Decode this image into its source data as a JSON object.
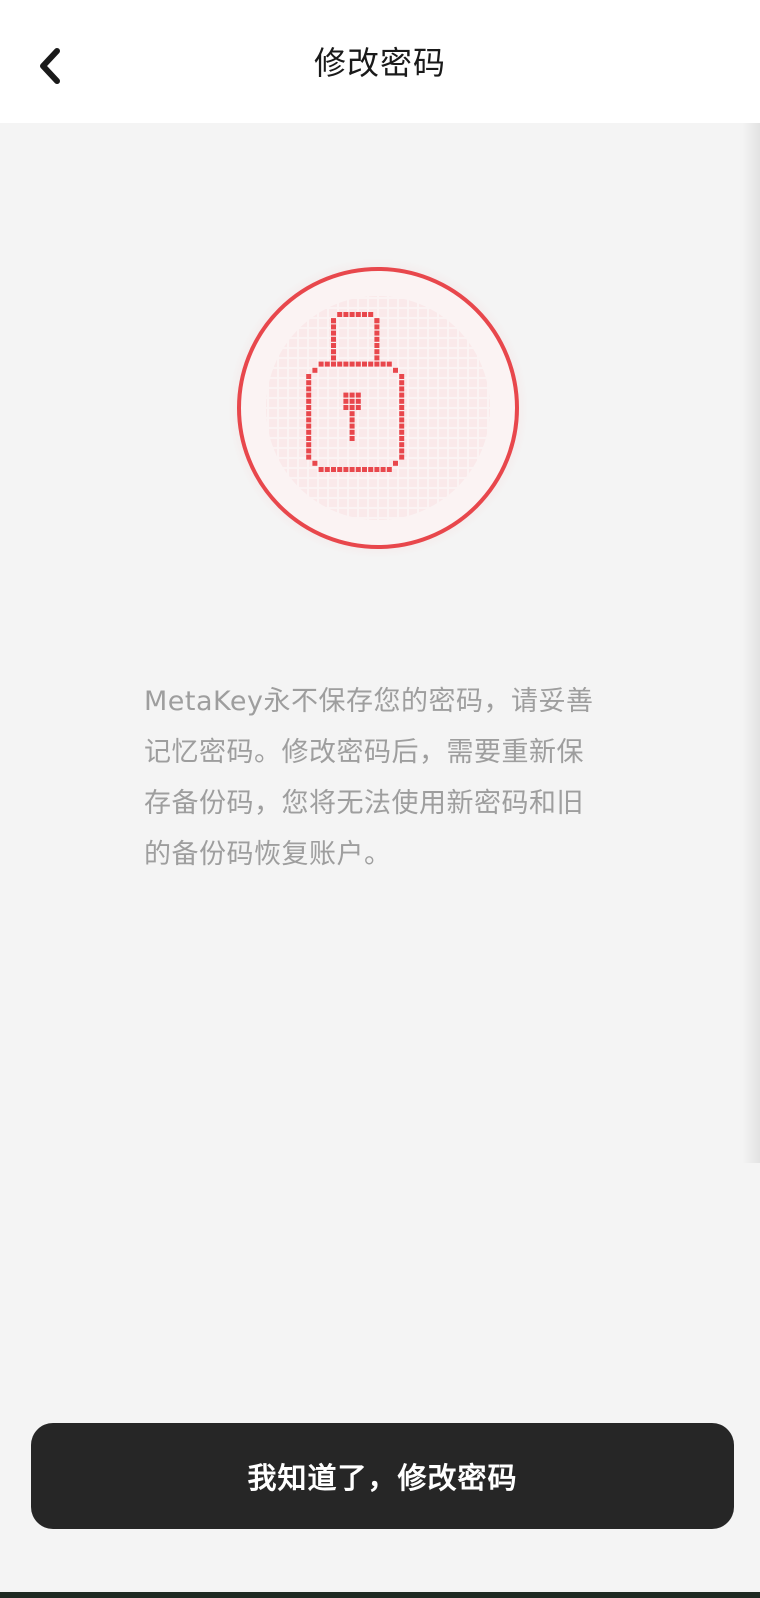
{
  "header": {
    "title": "修改密码",
    "back_icon": "chevron-left-icon"
  },
  "hero": {
    "icon": "pixel-lock-icon",
    "accent_color": "#e8474c"
  },
  "description": {
    "lines": [
      "MetaKey永不保存您的密码，请妥善",
      "记忆密码。修改密码后，需要重新保",
      "存备份码，您将无法使用新密码和旧",
      "的备份码恢复账户。"
    ]
  },
  "footer": {
    "confirm_label": "我知道了，修改密码"
  }
}
